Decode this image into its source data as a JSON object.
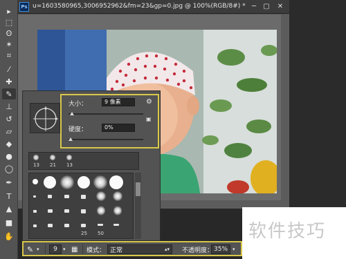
{
  "window": {
    "app_badge": "Ps",
    "doc_title": "u=1603580965,3006952962&fm=23&gp=0.jpg @ 100%(RGB/8#) *",
    "minimize_icon": "minimize-icon",
    "restore_icon": "restore-icon",
    "close_icon": "close-icon"
  },
  "tools": [
    {
      "name": "move-tool-icon",
      "glyph": "▸"
    },
    {
      "name": "marquee-tool-icon",
      "glyph": "⬚"
    },
    {
      "name": "lasso-tool-icon",
      "glyph": "ʘ"
    },
    {
      "name": "magic-wand-tool-icon",
      "glyph": "✶"
    },
    {
      "name": "crop-tool-icon",
      "glyph": "⌗"
    },
    {
      "name": "eyedropper-tool-icon",
      "glyph": "⁄"
    },
    {
      "name": "healing-brush-tool-icon",
      "glyph": "✚"
    },
    {
      "name": "brush-tool-icon",
      "glyph": "✎",
      "active": true
    },
    {
      "name": "clone-stamp-tool-icon",
      "glyph": "⊥"
    },
    {
      "name": "history-brush-tool-icon",
      "glyph": "↺"
    },
    {
      "name": "eraser-tool-icon",
      "glyph": "▱"
    },
    {
      "name": "paint-bucket-tool-icon",
      "glyph": "◆"
    },
    {
      "name": "blur-tool-icon",
      "glyph": "●"
    },
    {
      "name": "dodge-tool-icon",
      "glyph": "◯"
    },
    {
      "name": "pen-tool-icon",
      "glyph": "✒"
    },
    {
      "name": "type-tool-icon",
      "glyph": "T"
    },
    {
      "name": "path-selection-tool-icon",
      "glyph": "▲"
    },
    {
      "name": "shape-tool-icon",
      "glyph": "■"
    },
    {
      "name": "hand-tool-icon",
      "glyph": "✋"
    }
  ],
  "brush_popup": {
    "size_label": "大小：",
    "size_value": "9 像素",
    "hardness_label": "硬度：",
    "hardness_value": "0%",
    "settings_icon": "gear-icon",
    "new_preset_icon": "new-preset-icon",
    "size_slider_fraction": 0.02,
    "hardness_slider_fraction": 0.0,
    "recent_brushes": [
      "13",
      "21",
      "13"
    ]
  },
  "preset_labels": [
    "25",
    "50"
  ],
  "options_bar": {
    "brush_size": "9",
    "mode_label": "模式：",
    "mode_value": "正常",
    "opacity_label": "不透明度：",
    "opacity_value": "35%",
    "brush_icon": "brush-tool-icon",
    "toggle_panel_icon": "brush-panel-toggle-icon"
  },
  "watermark": "软件技巧",
  "colors": {
    "highlight": "#d8c84a",
    "panel": "#535353",
    "canvas_bg": "#6b6b6b"
  }
}
